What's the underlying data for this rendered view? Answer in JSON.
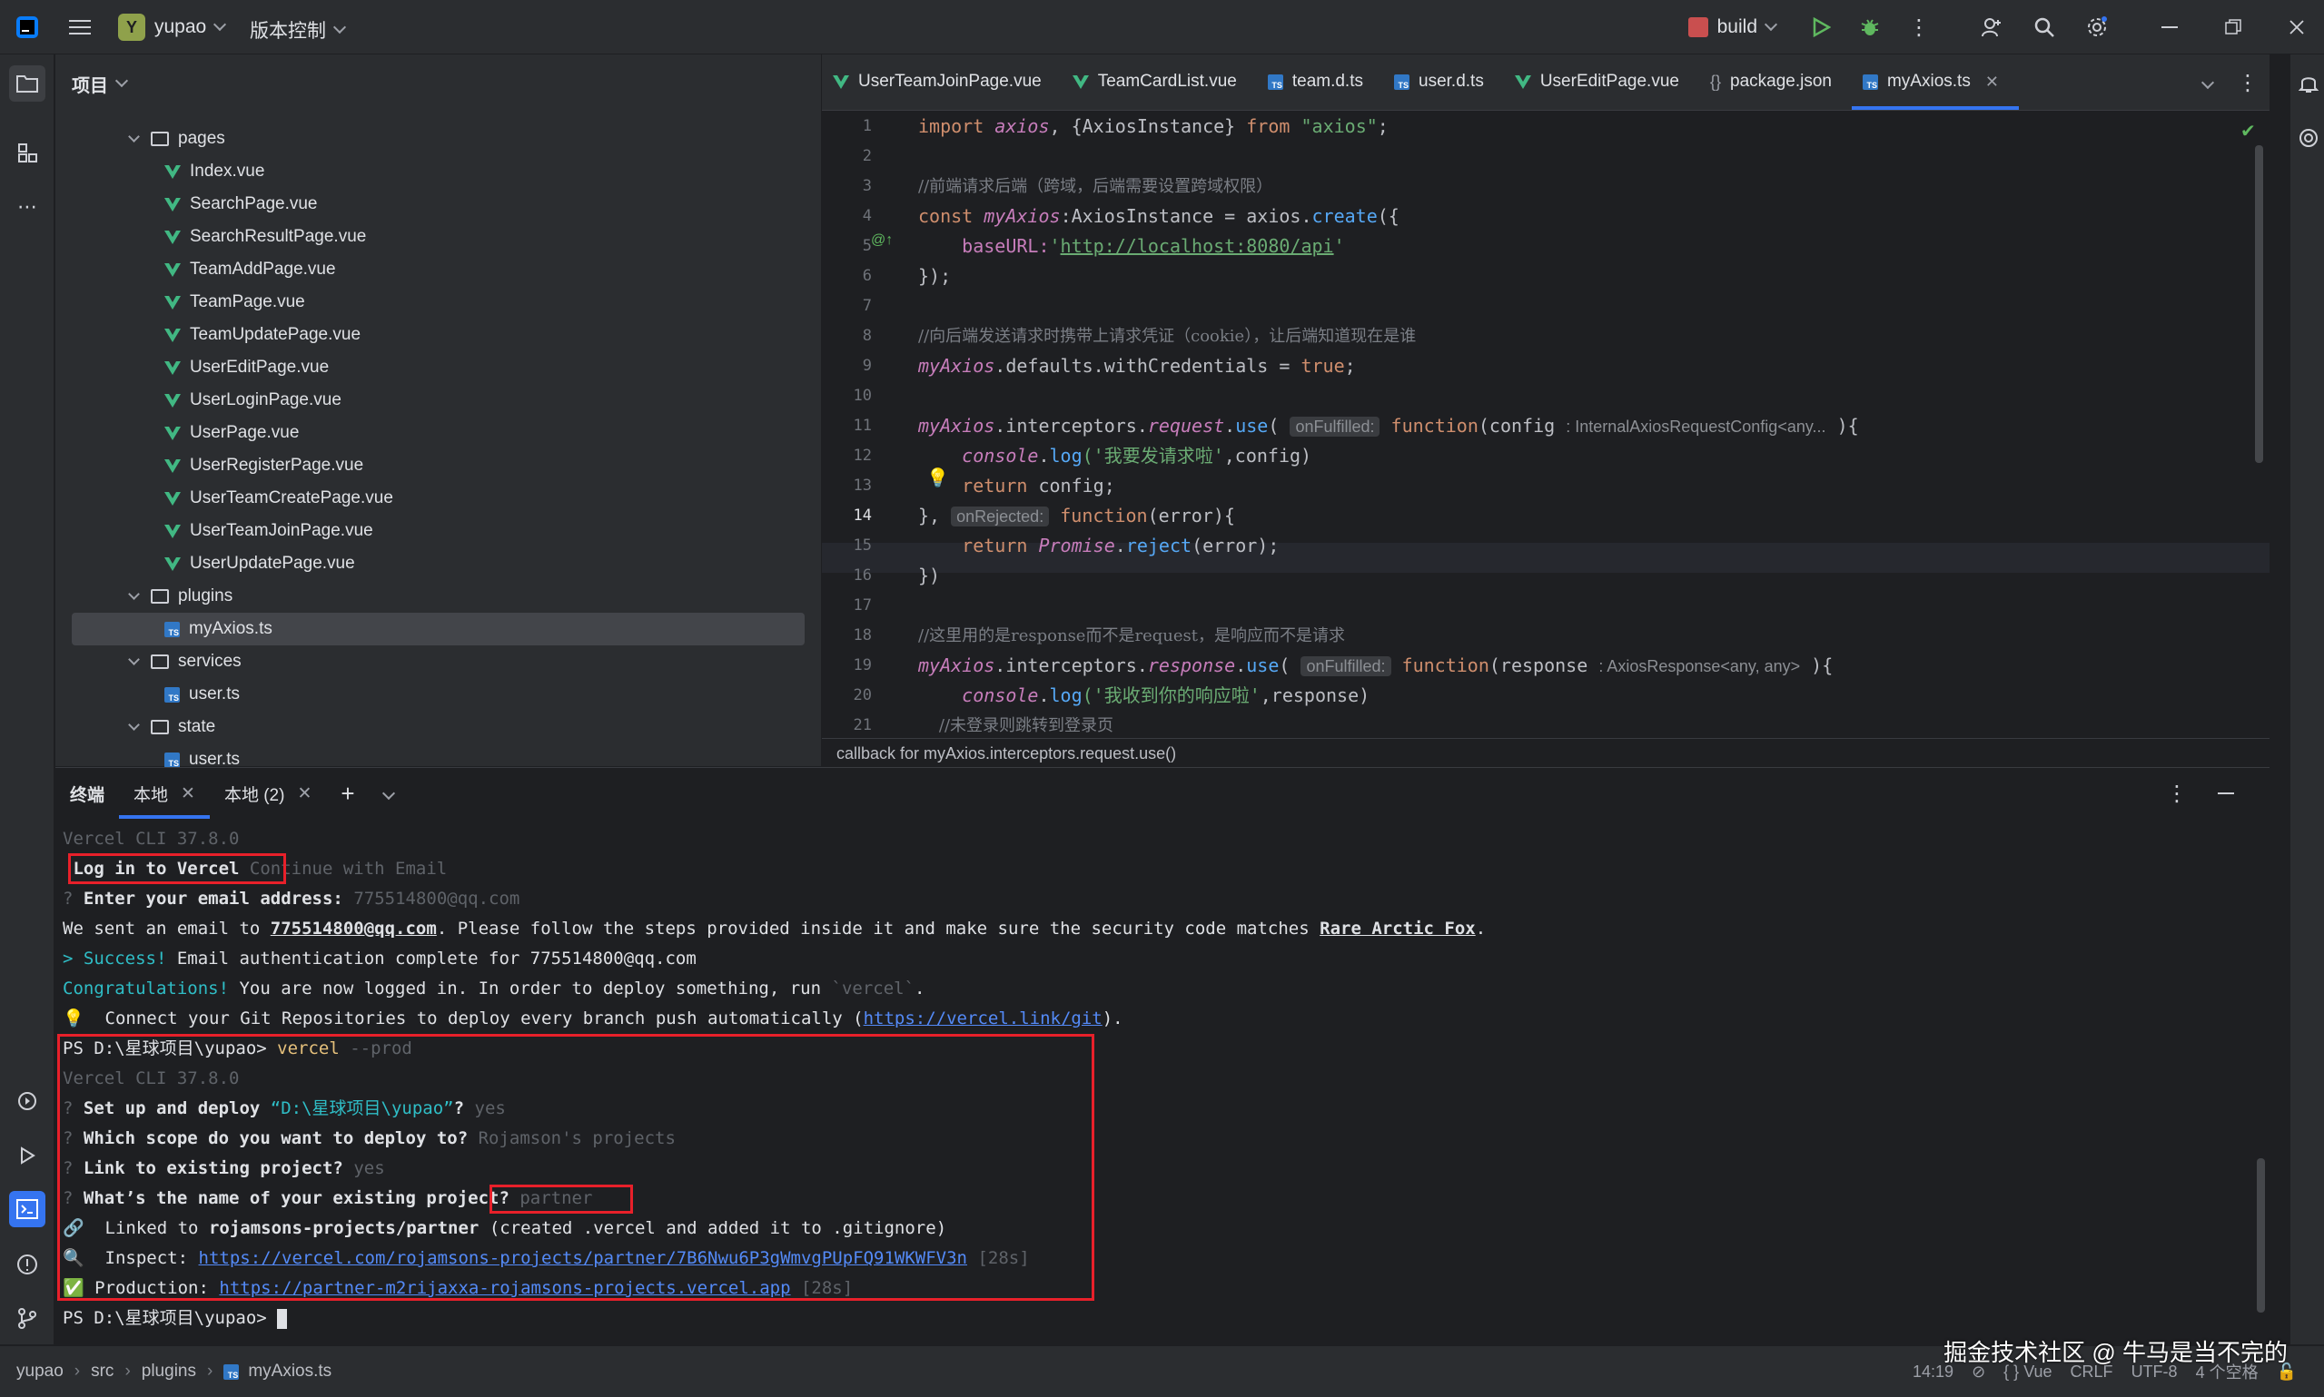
{
  "titlebar": {
    "project_badge": "Y",
    "project_name": "yupao",
    "vcs_label": "版本控制",
    "run_config": "build"
  },
  "project_panel": {
    "title": "项目",
    "tree": [
      {
        "type": "folder",
        "label": "pages",
        "depth": 1
      },
      {
        "type": "vue",
        "label": "Index.vue",
        "depth": 2
      },
      {
        "type": "vue",
        "label": "SearchPage.vue",
        "depth": 2
      },
      {
        "type": "vue",
        "label": "SearchResultPage.vue",
        "depth": 2
      },
      {
        "type": "vue",
        "label": "TeamAddPage.vue",
        "depth": 2
      },
      {
        "type": "vue",
        "label": "TeamPage.vue",
        "depth": 2
      },
      {
        "type": "vue",
        "label": "TeamUpdatePage.vue",
        "depth": 2
      },
      {
        "type": "vue",
        "label": "UserEditPage.vue",
        "depth": 2
      },
      {
        "type": "vue",
        "label": "UserLoginPage.vue",
        "depth": 2
      },
      {
        "type": "vue",
        "label": "UserPage.vue",
        "depth": 2
      },
      {
        "type": "vue",
        "label": "UserRegisterPage.vue",
        "depth": 2
      },
      {
        "type": "vue",
        "label": "UserTeamCreatePage.vue",
        "depth": 2
      },
      {
        "type": "vue",
        "label": "UserTeamJoinPage.vue",
        "depth": 2
      },
      {
        "type": "vue",
        "label": "UserUpdatePage.vue",
        "depth": 2
      },
      {
        "type": "folder",
        "label": "plugins",
        "depth": 1
      },
      {
        "type": "ts",
        "label": "myAxios.ts",
        "depth": 2,
        "selected": true
      },
      {
        "type": "folder",
        "label": "services",
        "depth": 1
      },
      {
        "type": "ts",
        "label": "user.ts",
        "depth": 2
      },
      {
        "type": "folder",
        "label": "state",
        "depth": 1
      },
      {
        "type": "ts",
        "label": "user.ts",
        "depth": 2
      }
    ]
  },
  "editor_tabs": [
    {
      "icon": "vue",
      "label": "UserTeamJoinPage.vue"
    },
    {
      "icon": "vue",
      "label": "TeamCardList.vue"
    },
    {
      "icon": "ts",
      "label": "team.d.ts"
    },
    {
      "icon": "ts",
      "label": "user.d.ts"
    },
    {
      "icon": "vue",
      "label": "UserEditPage.vue"
    },
    {
      "icon": "json",
      "label": "package.json"
    },
    {
      "icon": "ts",
      "label": "myAxios.ts",
      "active": true
    }
  ],
  "line_numbers": [
    "1",
    "2",
    "3",
    "4",
    "5",
    "6",
    "7",
    "8",
    "9",
    "10",
    "11",
    "12",
    "13",
    "14",
    "15",
    "16",
    "17",
    "18",
    "19",
    "20",
    "21"
  ],
  "current_line": "14",
  "code": {
    "l1_import": "import",
    "l1_axios": "axios",
    "l1_mid": ", {AxiosInstance} ",
    "l1_from": "from",
    "l1_str": "\"axios\"",
    "l1_end": ";",
    "l3": "//前端请求后端（跨域，后端需要设置跨域权限）",
    "l4_const": "const",
    "l4_name": "myAxios",
    "l4_mid": ":AxiosInstance = axios.",
    "l4_fn": "create",
    "l4_end": "({",
    "l5_key": "    baseURL:",
    "l5_q1": "'",
    "l5_url": "http://localhost:8080/api",
    "l5_q2": "'",
    "l6": "});",
    "l8": "//向后端发送请求时携带上请求凭证（cookie），让后端知道现在是谁",
    "l9_obj": "myAxios",
    "l9_mid": ".defaults.withCredentials = ",
    "l9_true": "true",
    "l9_end": ";",
    "l11_obj": "myAxios",
    "l11_p1": ".interceptors.",
    "l11_prop": "request",
    "l11_p2": ".",
    "l11_use": "use",
    "l11_p3": "( ",
    "l11_hint": "onFulfilled:",
    "l11_fn": " function",
    "l11_p4": "(config ",
    "l11_type": ": InternalAxiosRequestConfig<any...",
    "l11_end": " ){",
    "l12_console": "    console",
    "l12_dot": ".",
    "l12_log": "log",
    "l12_str": "('我要发请求啦'",
    "l12_end": ",config)",
    "l13_ret": "    return",
    "l13_end": " config;",
    "l14_a": "}, ",
    "l14_hint": "onRejected:",
    "l14_fn": " function",
    "l14_end": "(error){",
    "l15_ret": "    return",
    "l15_sp": " ",
    "l15_promise": "Promise",
    "l15_dot": ".",
    "l15_reject": "reject",
    "l15_end": "(error);",
    "l16": "})",
    "l18": "//这里用的是response而不是request，是响应而不是请求",
    "l19_obj": "myAxios",
    "l19_p1": ".interceptors.",
    "l19_prop": "response",
    "l19_p2": ".",
    "l19_use": "use",
    "l19_p3": "( ",
    "l19_hint": "onFulfilled:",
    "l19_fn": " function",
    "l19_p4": "(response ",
    "l19_type": ": AxiosResponse<any, any>",
    "l19_end": " ){",
    "l20_console": "    console",
    "l20_dot": ".",
    "l20_log": "log",
    "l20_str": "('我收到你的响应啦'",
    "l20_end": ",response)",
    "l21": "    //未登录则跳转到登录页"
  },
  "editor_breadcrumb": "callback for myAxios.interceptors.request.use()",
  "terminal": {
    "title": "终端",
    "tabs": [
      "本地",
      "本地 (2)"
    ],
    "lines": {
      "t0": "Vercel CLI 37.8.0",
      "t1_sel": " Log in to Vercel",
      "t1_rest": " Continue with Email",
      "t2_q": "? ",
      "t2_label": "Enter your email address: ",
      "t2_val": "775514800@qq.com",
      "t3_a": "We sent an email to ",
      "t3_email": "775514800@qq.com",
      "t3_b": ". Please follow the steps provided inside it and make sure the security code matches ",
      "t3_code": "Rare Arctic Fox",
      "t3_c": ".",
      "t4_succ": "> Success!",
      "t4_rest": " Email authentication complete for 775514800@qq.com",
      "t5_cong": "Congratulations!",
      "t5_rest": " You are now logged in. In order to deploy something, run ",
      "t5_cmd": "`vercel`",
      "t5_end": ".",
      "t6_bulb": "💡",
      "t6_text": "  Connect your Git Repositories to deploy every branch push automatically (",
      "t6_link": "https://vercel.link/git",
      "t6_end": ").",
      "t7_ps": "PS D:\\星球项目\\yupao> ",
      "t7_cmd": "vercel",
      "t7_arg": " --prod",
      "t8": "Vercel CLI 37.8.0",
      "t9_q": "? ",
      "t9_label": "Set up and deploy ",
      "t9_path": "“D:\\星球项目\\yupao”",
      "t9_q2": "? ",
      "t9_ans": "yes",
      "t10_q": "? ",
      "t10_label": "Which scope do you want to deploy to? ",
      "t10_ans": "Rojamson's projects",
      "t11_q": "? ",
      "t11_label": "Link to existing project? ",
      "t11_ans": "yes",
      "t12_q": "? ",
      "t12_label": "What’s the name of your existing project? ",
      "t12_ans": "partner",
      "t13_icon": "🔗",
      "t13_a": "  Linked to ",
      "t13_proj": "rojamsons-projects/partner",
      "t13_b": " (created .vercel and added it to .gitignore)",
      "t14_icon": "🔍",
      "t14_a": "  Inspect: ",
      "t14_link": "https://vercel.com/rojamsons-projects/partner/7B6Nwu6P3gWmvgPUpFQ91WKWFV3n",
      "t14_time": " [28s]",
      "t15_icon": "✅",
      "t15_a": " Production: ",
      "t15_link": "https://partner-m2rijaxxa-rojamsons-projects.vercel.app",
      "t15_time": " [28s]",
      "t16_ps": "PS D:\\星球项目\\yupao> "
    }
  },
  "statusbar": {
    "crumbs": [
      "yupao",
      "src",
      "plugins",
      "myAxios.ts"
    ],
    "position": "14:19",
    "lang": "Vue",
    "line_sep": "CRLF",
    "encoding": "UTF-8",
    "indent": "4 个空格"
  },
  "watermark": "掘金技术社区 @ 牛马是当不完的",
  "colors": {
    "accent": "#3574f0",
    "highlight_box": "#e8202a"
  }
}
